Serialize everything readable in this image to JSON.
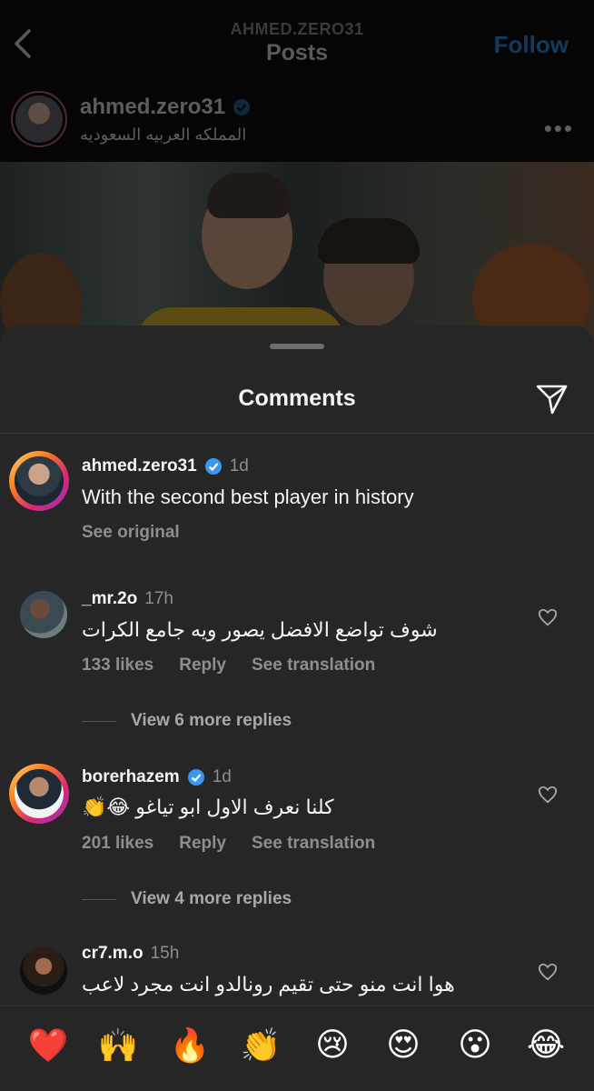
{
  "header": {
    "username_small": "AHMED.ZERO31",
    "title": "Posts",
    "follow_label": "Follow"
  },
  "post": {
    "username": "ahmed.zero31",
    "location": "المملكه العربيه السعوديه",
    "more": "•••"
  },
  "sheet": {
    "title": "Comments"
  },
  "caption": {
    "username": "ahmed.zero31",
    "time": "1d",
    "text": "With the second best player in history",
    "see_original": "See original"
  },
  "comments": [
    {
      "username": "_mr.2o",
      "time": "17h",
      "text": "شوف تواضع الافضل يصور ويه جامع الكرات",
      "likes": "133 likes",
      "reply": "Reply",
      "translate": "See translation",
      "view_replies": "View 6 more replies"
    },
    {
      "username": "borerhazem",
      "time": "1d",
      "text": "كلنا نعرف الاول ابو تياغو 😂👏",
      "likes": "201 likes",
      "reply": "Reply",
      "translate": "See translation",
      "view_replies": "View 4 more replies"
    },
    {
      "username": "cr7.m.o",
      "time": "15h",
      "text": "هوا انت منو حتى تقيم رونالدو  انت مجرد لاعب"
    }
  ],
  "emoji_bar": [
    "❤️",
    "🙌",
    "🔥",
    "👏",
    "😢",
    "😍",
    "😮",
    "😂"
  ],
  "colors": {
    "sheet_bg": "#262626",
    "verified": "#3897f0",
    "muted_text": "#8e8e8e"
  }
}
